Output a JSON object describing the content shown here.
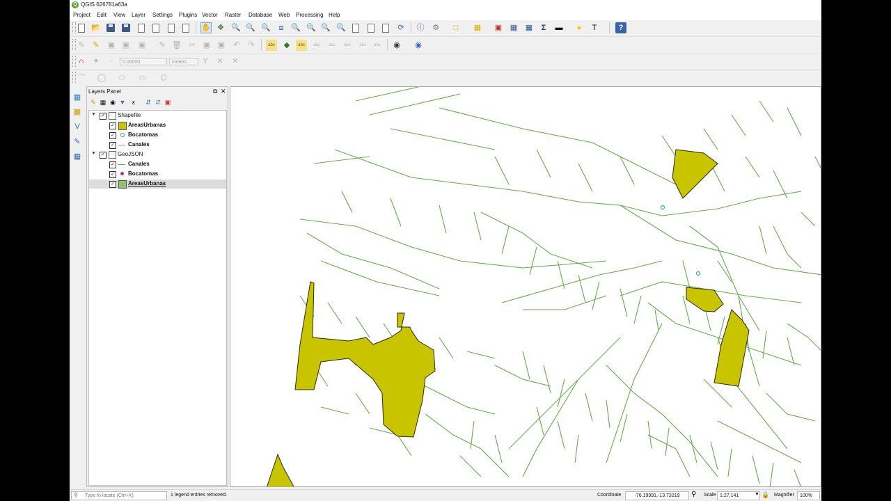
{
  "window": {
    "title": "QGIS 626781a63a",
    "logo_letter": "Q"
  },
  "menu": [
    "Project",
    "Edit",
    "View",
    "Layer",
    "Settings",
    "Plugins",
    "Vector",
    "Raster",
    "Database",
    "Web",
    "Processing",
    "Help"
  ],
  "toolbar": {
    "snapping_tolerance": "0.00000",
    "units": "meters",
    "icons": [
      "new-project",
      "open-project",
      "save-project",
      "save-as",
      "new-print-layout",
      "layout-manager",
      "style-manager",
      "pan-map",
      "pan-to-selection",
      "zoom-in",
      "zoom-out",
      "zoom-native",
      "zoom-full",
      "zoom-to-selection",
      "zoom-to-layer",
      "zoom-last",
      "zoom-next",
      "new-bookmark",
      "show-bookmarks",
      "show-map-tips",
      "refresh",
      "identify",
      "measure",
      "select-features",
      "deselect",
      "open-attribute-table",
      "field-calculator",
      "statistical-summary",
      "measure-line",
      "map-tips",
      "text-annotation",
      "help"
    ]
  },
  "layers_panel": {
    "title": "Layers Panel",
    "groups": [
      {
        "name": "Shapefile",
        "checked": true,
        "expanded": true,
        "layers": [
          {
            "name": "AreasUrbanas",
            "symbol": "polygon",
            "color": "#c8c400",
            "checked": true,
            "bold": true
          },
          {
            "name": "Bocatomas",
            "symbol": "point",
            "color": "#3aa8a0",
            "checked": true,
            "bold": true
          },
          {
            "name": "Canales",
            "symbol": "line",
            "color": "#6aa84f",
            "checked": true,
            "bold": true
          }
        ]
      },
      {
        "name": "GeoJSON",
        "checked": true,
        "expanded": true,
        "layers": [
          {
            "name": "Canales",
            "symbol": "line",
            "color": "#6aa84f",
            "checked": true,
            "bold": true
          },
          {
            "name": "Bocatomas",
            "symbol": "point",
            "color": "#b03a5a",
            "checked": true,
            "bold": true
          },
          {
            "name": "AreasUrbanas",
            "symbol": "polygon",
            "color": "#90c470",
            "checked": true,
            "bold": true,
            "selected": true,
            "underline": true
          }
        ]
      }
    ]
  },
  "map": {
    "polygon_fill": "#c8c400",
    "polygon_stroke": "#2a2a00",
    "line_color": "#6aa84f",
    "point_color": "#3aa8a0"
  },
  "status": {
    "locate_placeholder": "Type to locate (Ctrl+K)",
    "message": "1 legend entries removed.",
    "coordinate_label": "Coordinate",
    "coordinate": "-76.19991,-13.73219",
    "scale_label": "Scale",
    "scale": "1:27,141",
    "magnifier_label": "Magnifier",
    "magnifier": "100%"
  }
}
